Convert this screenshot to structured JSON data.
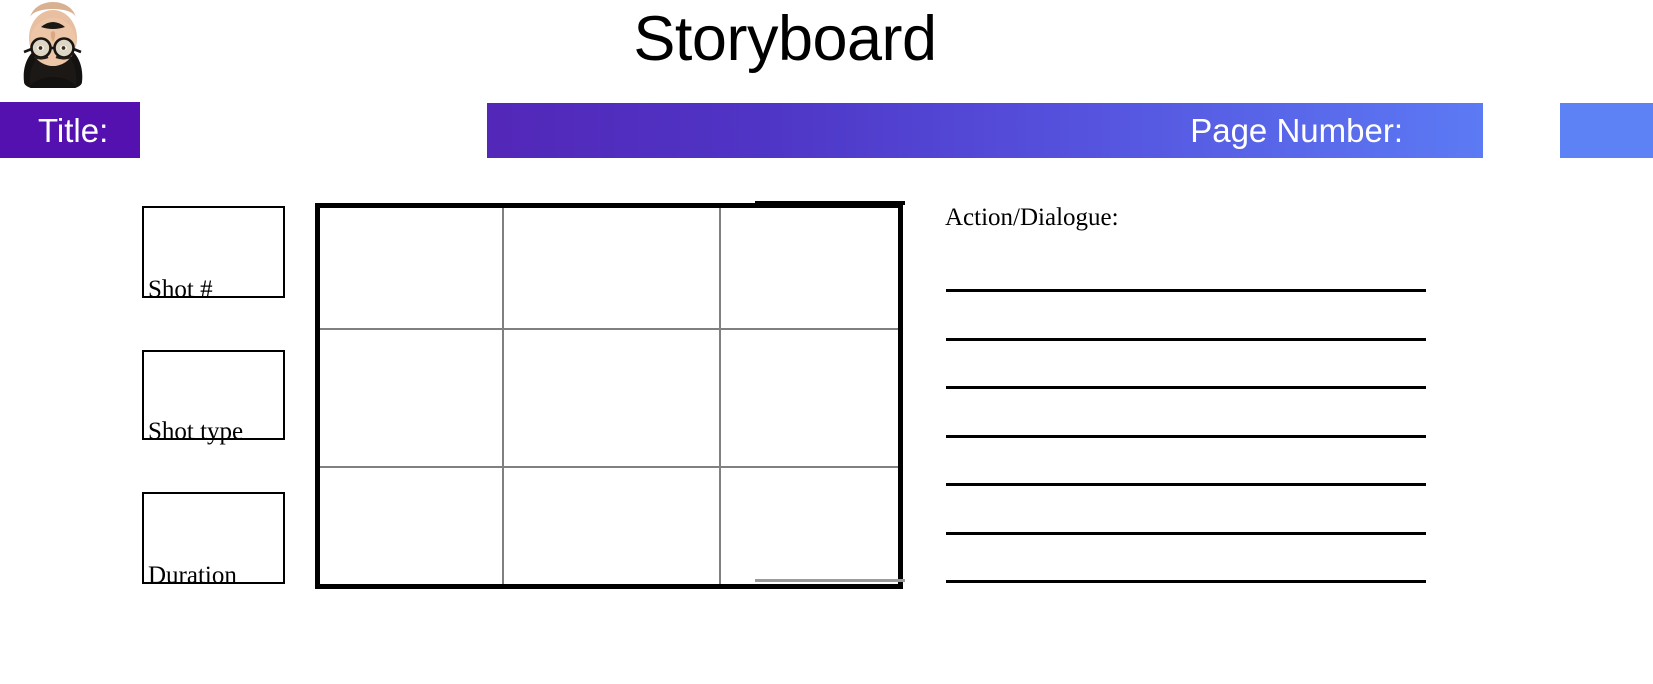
{
  "header": {
    "title": "Storyboard",
    "avatar_icon": "portrait-avatar-icon"
  },
  "banner": {
    "title_label": "Title:",
    "page_number_label": "Page Number:",
    "title_box_color": "#5510b0",
    "gradient_start_color": "#5327b8",
    "gradient_end_color": "#5c7af4",
    "edge_box_color": "#5c82f5"
  },
  "meta_boxes": [
    {
      "label": "Shot #"
    },
    {
      "label": "Shot type"
    },
    {
      "label": "Duration"
    }
  ],
  "storyboard": {
    "columns": 3,
    "rows": 3,
    "outer_border_color": "#000000",
    "inner_line_color": "#808080",
    "cells": [
      {
        "content": ""
      },
      {
        "content": ""
      },
      {
        "content": ""
      },
      {
        "content": ""
      },
      {
        "content": ""
      },
      {
        "content": ""
      },
      {
        "content": ""
      },
      {
        "content": ""
      },
      {
        "content": ""
      }
    ]
  },
  "action_dialogue": {
    "label": "Action/Dialogue:",
    "line_count": 7,
    "lines": [
      "",
      "",
      "",
      "",
      "",
      "",
      ""
    ]
  }
}
